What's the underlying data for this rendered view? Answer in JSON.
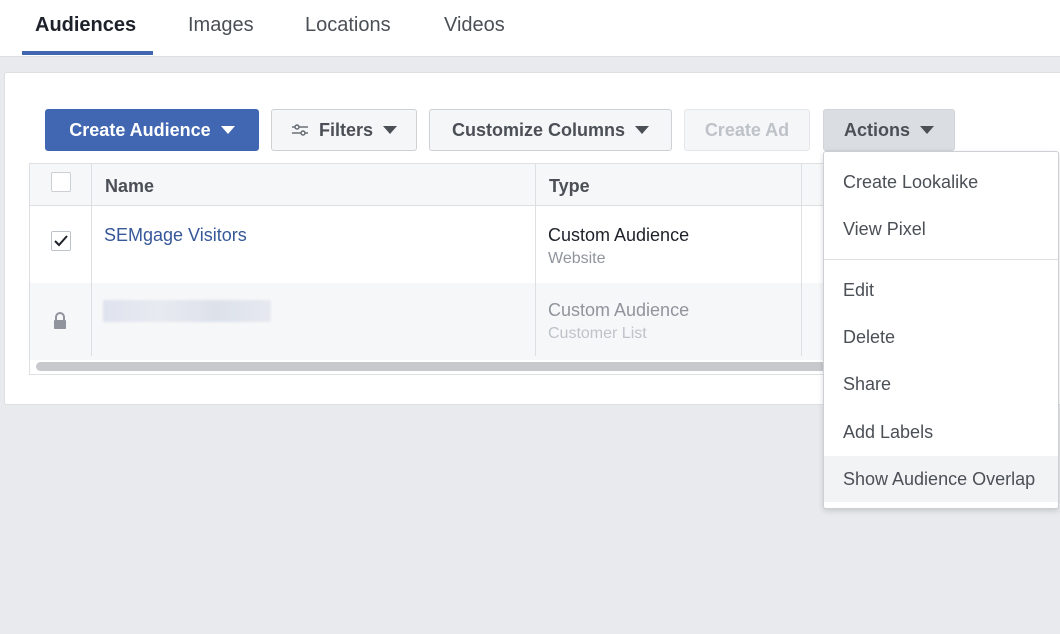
{
  "tabs": [
    {
      "label": "Audiences",
      "active": true
    },
    {
      "label": "Images",
      "active": false
    },
    {
      "label": "Locations",
      "active": false
    },
    {
      "label": "Videos",
      "active": false
    }
  ],
  "toolbar": {
    "create_audience": "Create Audience",
    "filters": "Filters",
    "customize_columns": "Customize Columns",
    "create_ad": "Create Ad",
    "actions": "Actions"
  },
  "table": {
    "headers": [
      "Name",
      "Type"
    ],
    "rows": [
      {
        "checked": true,
        "name": "SEMgage Visitors",
        "type": "Custom Audience",
        "subtype": "Website",
        "locked": false
      },
      {
        "checked": false,
        "name": "",
        "type": "Custom Audience",
        "subtype": "Customer List",
        "locked": true
      }
    ]
  },
  "actions_menu": {
    "items": [
      "Create Lookalike",
      "View Pixel",
      "Edit",
      "Delete",
      "Share",
      "Add Labels",
      "Show Audience Overlap"
    ],
    "highlighted": "Show Audience Overlap"
  },
  "colors": {
    "primary": "#4267b2",
    "link": "#365899",
    "background": "#e9eaed"
  }
}
